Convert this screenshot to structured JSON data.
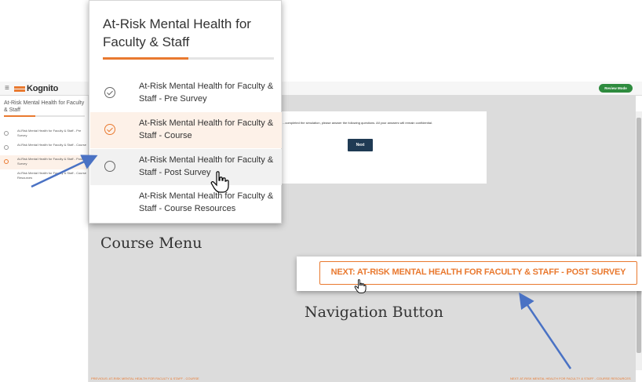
{
  "app": {
    "logo_text": "Kognito",
    "menu_glyph": "≡",
    "review_badge": "Review Mode",
    "accent_color": "#e9792f",
    "navy_color": "#1f3a54"
  },
  "sidebar": {
    "title": "At-Risk Mental Health for Faculty & Staff",
    "items": [
      {
        "label": "At-Risk Mental Health for Faculty & Staff - Pre Survey",
        "state": "done"
      },
      {
        "label": "At-Risk Mental Health for Faculty & Staff - Course",
        "state": "done"
      },
      {
        "label": "At-Risk Mental Health for Faculty & Staff - Post Survey",
        "state": "active"
      },
      {
        "label": "At-Risk Mental Health for Faculty & Staff - Course Resources",
        "state": "none"
      }
    ]
  },
  "main": {
    "instruction_text": "...completed the simulation, please answer the following questions. All your answers will remain confidential.",
    "next_button": "Next",
    "bottom_prev": "PREVIOUS: AT-RISK MENTAL HEALTH FOR FACULTY & STAFF - COURSE",
    "bottom_next": "NEXT: AT-RISK MENTAL HEALTH FOR FACULTY & STAFF - COURSE RESOURCES"
  },
  "course_menu": {
    "title": "At-Risk Mental Health for Faculty & Staff",
    "progress": 0.5,
    "items": [
      {
        "label": "At-Risk Mental Health for Faculty & Staff - Pre Survey",
        "icon": "check-circle-icon",
        "state": "done"
      },
      {
        "label": "At-Risk Mental Health for Faculty & Staff - Course",
        "icon": "check-circle-icon",
        "state": "active"
      },
      {
        "label": "At-Risk Mental Health for Faculty & Staff - Post Survey",
        "icon": "circle-icon",
        "state": "hover"
      },
      {
        "label": "At-Risk Mental Health for Faculty & Staff - Course Resources",
        "icon": "",
        "state": "none"
      }
    ]
  },
  "navigation_button": {
    "label": "NEXT: AT-RISK MENTAL HEALTH FOR FACULTY & STAFF - POST SURVEY"
  },
  "captions": {
    "course_menu": "Course Menu",
    "navigation_button": "Navigation Button"
  },
  "annotation_arrow_color": "#4a72c4"
}
